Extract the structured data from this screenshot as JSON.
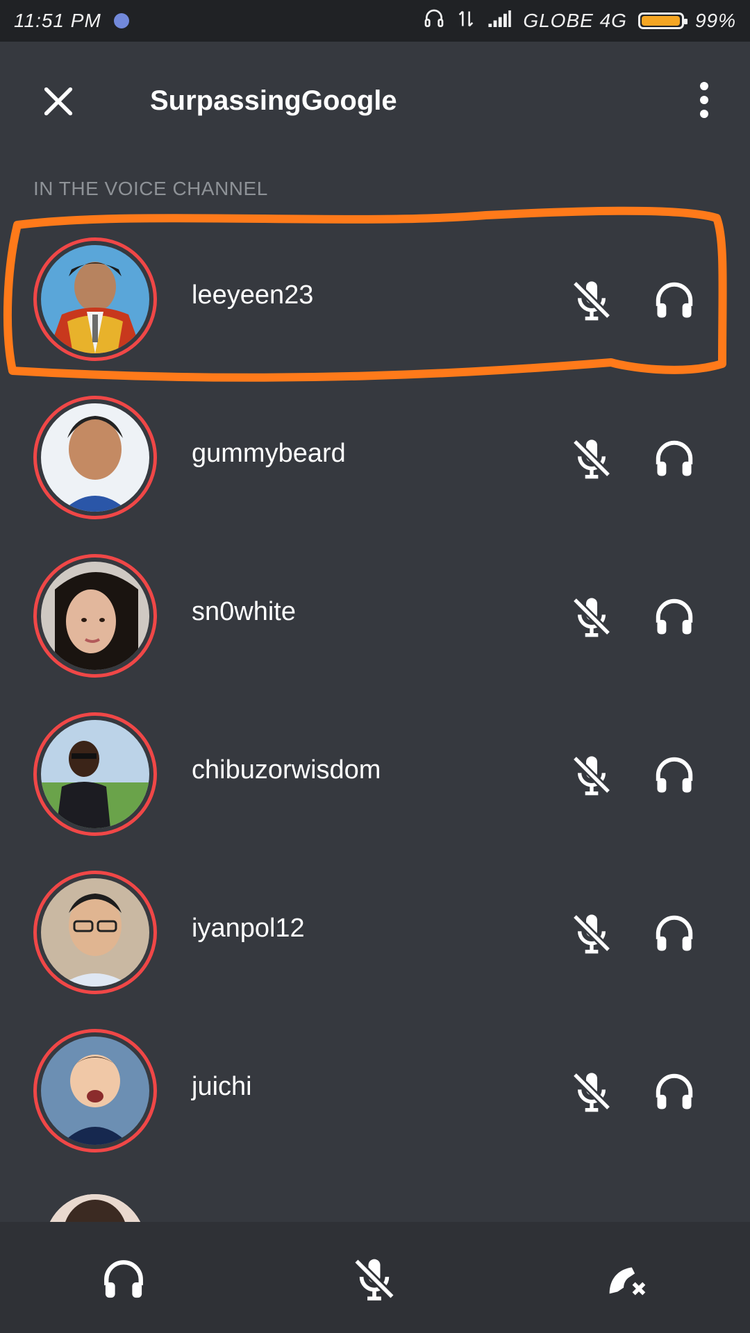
{
  "status_bar": {
    "time": "11:51 PM",
    "carrier": "GLOBE 4G",
    "battery": "99%",
    "battery_level": 0.99,
    "icons": [
      "discord-icon",
      "headset-icon",
      "data-arrows-icon",
      "signal-icon",
      "battery-icon"
    ]
  },
  "header": {
    "title": "SurpassingGoogle",
    "close_icon": "close-icon",
    "menu_icon": "more-vertical-icon"
  },
  "section": {
    "label": "IN THE VOICE CHANNEL"
  },
  "members": [
    {
      "name": "leeyeen23",
      "speaking": false,
      "muted": true,
      "deafened": false,
      "highlighted": true
    },
    {
      "name": "gummybeard",
      "speaking": false,
      "muted": true,
      "deafened": false
    },
    {
      "name": "sn0white",
      "speaking": false,
      "muted": true,
      "deafened": false
    },
    {
      "name": "chibuzorwisdom",
      "speaking": false,
      "muted": true,
      "deafened": false
    },
    {
      "name": "iyanpol12",
      "speaking": false,
      "muted": true,
      "deafened": false
    },
    {
      "name": "juichi",
      "speaking": false,
      "muted": true,
      "deafened": false
    }
  ],
  "colors": {
    "background": "#36393f",
    "status_bar": "#202225",
    "bottom_bar": "#2f3136",
    "avatar_ring": "#f04747",
    "highlight": "#ff7a1a",
    "section_label": "#8e9297",
    "battery": "#f5a623"
  },
  "bottom_bar": {
    "buttons": [
      "headset-icon",
      "mic-off-icon",
      "disconnect-icon"
    ]
  }
}
